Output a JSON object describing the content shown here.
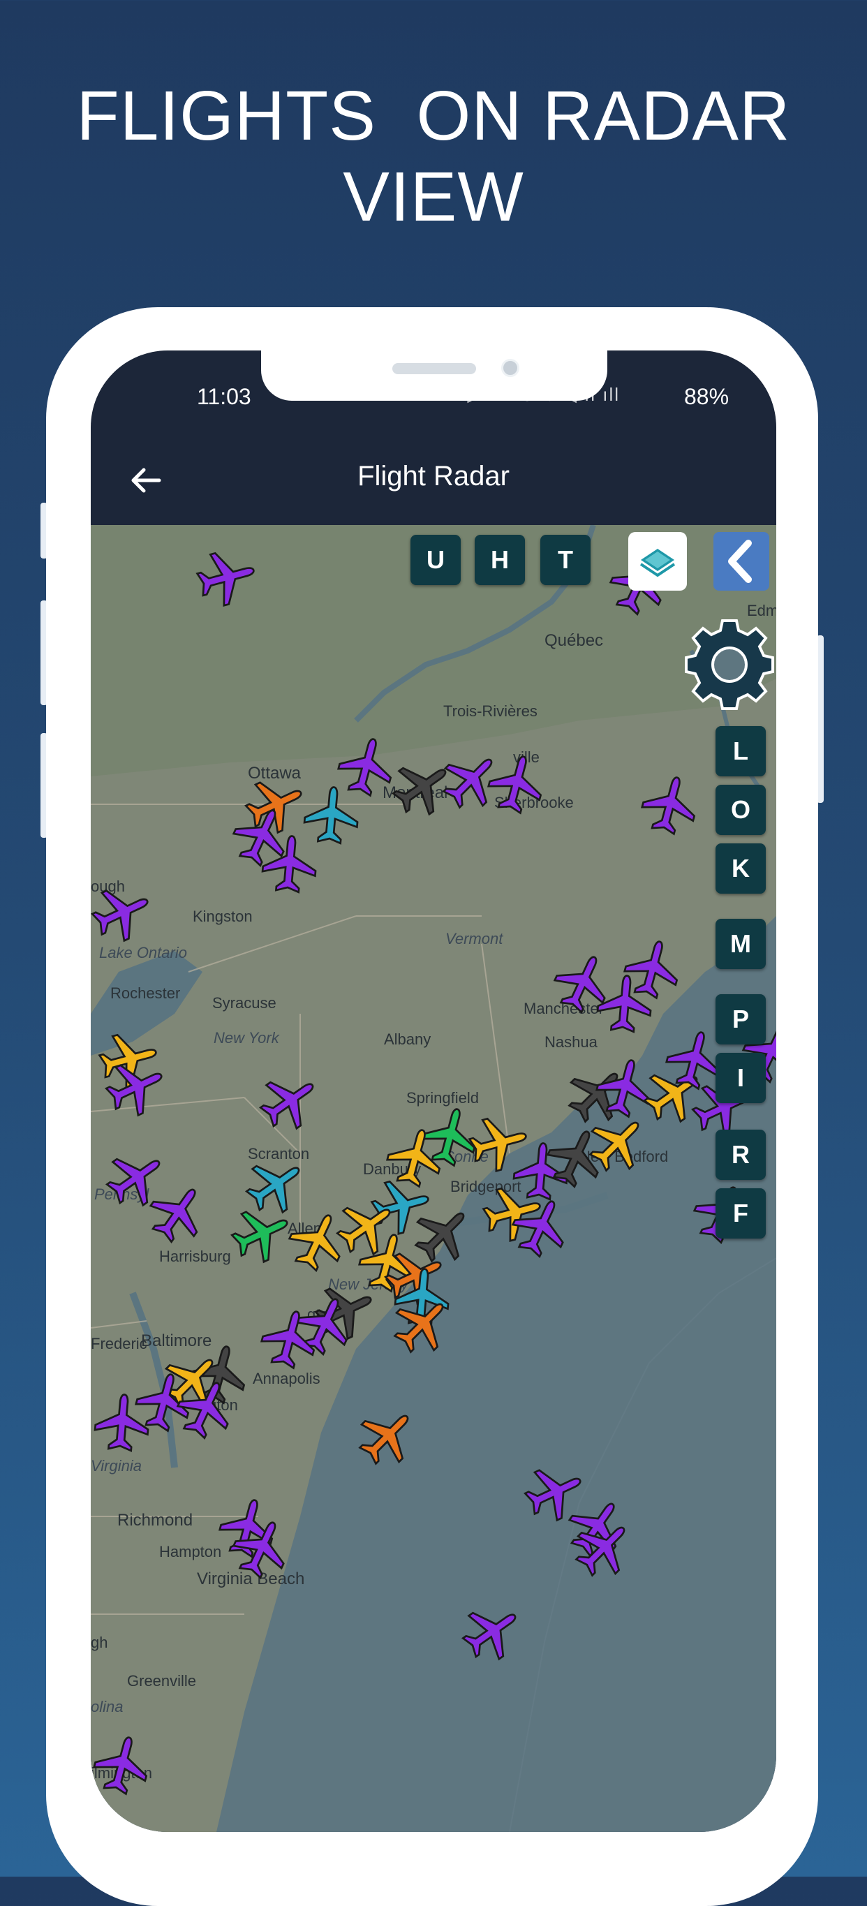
{
  "headline": {
    "line1": "FLIGHTS  ON RADAR",
    "line2": "VIEW"
  },
  "status_bar": {
    "time": "11:03",
    "network_icons": "⚡ ▷ KB/s ⇅ ◁ ıl ıll",
    "battery": "88%"
  },
  "app_bar": {
    "title": "Flight Radar",
    "back_icon": "arrow-left-icon"
  },
  "map_controls": {
    "top_buttons": [
      "U",
      "H",
      "T"
    ],
    "layers_icon": "layers-icon",
    "collapse_icon": "chevron-left-icon",
    "settings_icon": "gear-icon",
    "side_letters": [
      "L",
      "O",
      "K",
      "M",
      "P",
      "I",
      "R",
      "F"
    ]
  },
  "map_labels": {
    "quebec": "Québec",
    "edmundston": "Edm",
    "trois_rivieres": "Trois-Rivières",
    "drummondville": "ville",
    "ottawa": "Ottawa",
    "montreal": "Montréal",
    "sherbrooke": "Sherbrooke",
    "peterborough": "ough",
    "kingston": "Kingston",
    "lake_ontario": "Lake Ontario",
    "vermont": "Vermont",
    "rochester": "Rochester",
    "syracuse": "Syracuse",
    "new_york_state": "New York",
    "albany": "Albany",
    "manchester": "Manchester",
    "nashua": "Nashua",
    "springfield": "Springfield",
    "scranton": "Scranton",
    "danbury": "Danbury",
    "connecticut": "Conne",
    "new_bedford": "New Bedford",
    "bridgeport": "Bridgeport",
    "pennsylvania": "Pennsyl",
    "allentown": "Allen",
    "harrisburg": "Harrisburg",
    "new_jersey": "New Jersey",
    "trenton": "gton",
    "frederick": "Frederic",
    "baltimore": "Baltimore",
    "annapolis": "Annapolis",
    "washington": "gton",
    "virginia": "Virginia",
    "richmond": "Richmond",
    "hampton": "Hampton",
    "virginia_beach": "Virginia Beach",
    "raleigh": "gh",
    "greenville": "Greenville",
    "carolina": "olina",
    "wilmington": "ilmington"
  },
  "colors": {
    "purple": "#8a2be2",
    "orange": "#e8731a",
    "cyan": "#2aa6c4",
    "yellow": "#f2b418",
    "green": "#1ebd5a",
    "gray": "#444444",
    "button_bg": "#0f3a43",
    "app_bar": "#1c2639",
    "background": "#244a74"
  }
}
